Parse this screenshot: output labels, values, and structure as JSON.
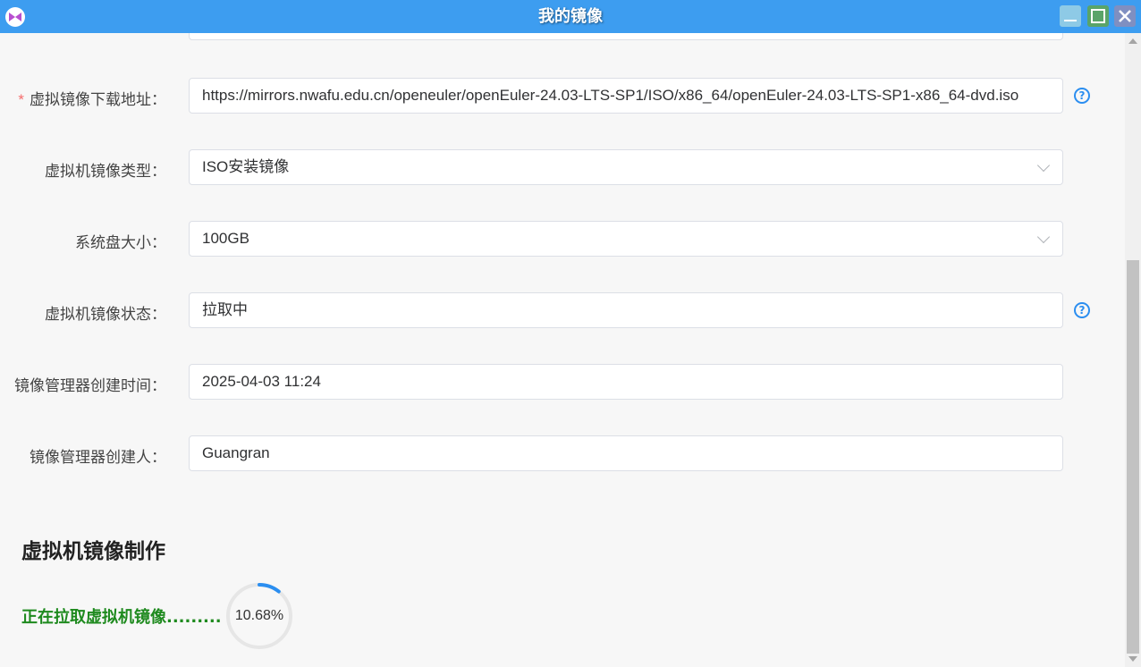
{
  "window": {
    "title": "我的镜像",
    "accent": "#3d9df0"
  },
  "form": {
    "url": {
      "label": "虚拟镜像下载地址：",
      "required_mark": "*",
      "value": "https://mirrors.nwafu.edu.cn/openeuler/openEuler-24.03-LTS-SP1/ISO/x86_64/openEuler-24.03-LTS-SP1-x86_64-dvd.iso"
    },
    "image_type": {
      "label": "虚拟机镜像类型：",
      "value": "ISO安装镜像"
    },
    "disk_size": {
      "label": "系统盘大小：",
      "value": "100GB"
    },
    "status": {
      "label": "虚拟机镜像状态：",
      "value": "拉取中"
    },
    "created_time": {
      "label": "镜像管理器创建时间：",
      "value": "2025-04-03 11:24"
    },
    "creator": {
      "label": "镜像管理器创建人：",
      "value": "Guangran"
    }
  },
  "build": {
    "title": "虚拟机镜像制作",
    "progress_text": "正在拉取虚拟机镜像.........",
    "progress_label": "10.68%",
    "progress_fraction": 0.1068,
    "progress_color": "#2b8ef0",
    "track_color": "#e6e6e6"
  },
  "icons": {
    "help": "question-circle-icon",
    "app": "app-logo-icon",
    "dropdown": "chevron-down-icon"
  }
}
